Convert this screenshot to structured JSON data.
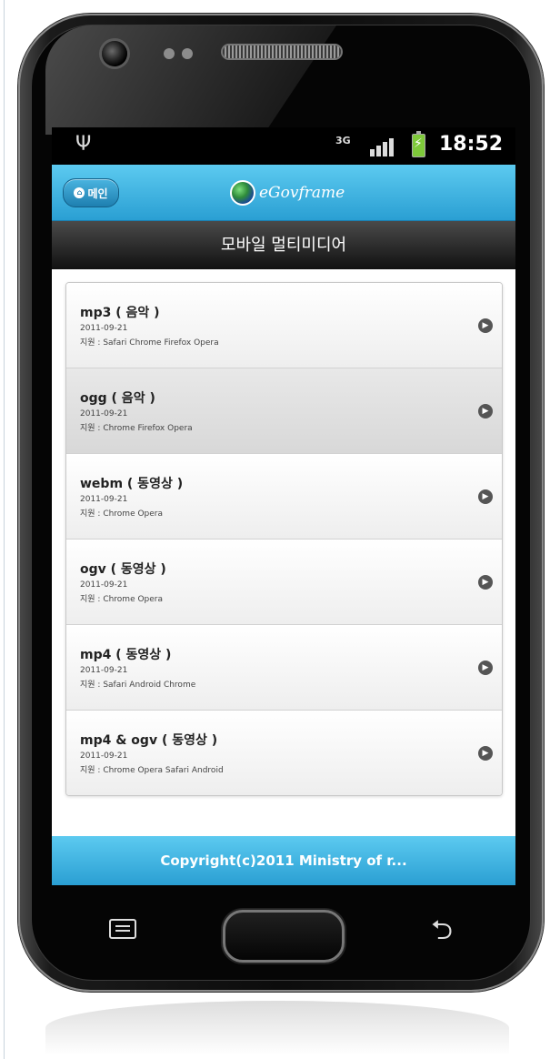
{
  "status_bar": {
    "network": "3G",
    "time": "18:52"
  },
  "header": {
    "home_label": "메인",
    "logo_text": "eGovframe"
  },
  "page_title": "모바일 멀티미디어",
  "items": [
    {
      "title": "mp3 ( 음악 )",
      "date": "2011-09-21",
      "support": "지원 : Safari Chrome Firefox Opera"
    },
    {
      "title": "ogg ( 음악 )",
      "date": "2011-09-21",
      "support": "지원 : Chrome Firefox Opera"
    },
    {
      "title": "webm ( 동영상 )",
      "date": "2011-09-21",
      "support": "지원 : Chrome Opera"
    },
    {
      "title": "ogv ( 동영상 )",
      "date": "2011-09-21",
      "support": "지원 : Chrome Opera"
    },
    {
      "title": "mp4 ( 동영상 )",
      "date": "2011-09-21",
      "support": "지원 : Safari Android Chrome"
    },
    {
      "title": "mp4 & ogv ( 동영상 )",
      "date": "2011-09-21",
      "support": "지원 : Chrome Opera Safari Android"
    }
  ],
  "footer": {
    "copyright": "Copyright(c)2011 Ministry of r..."
  },
  "colors": {
    "header_blue": "#2a9fd3",
    "title_bar": "#111111"
  },
  "icons": {
    "usb": "usb-icon",
    "signal": "signal-icon",
    "battery": "battery-icon",
    "arrow": "chevron-right-icon"
  }
}
